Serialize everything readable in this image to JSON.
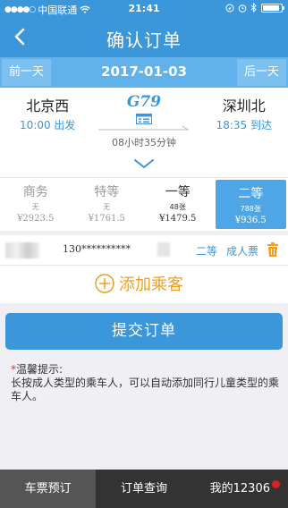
{
  "status_bar": {
    "carrier": "中国联通",
    "time": "21:41",
    "battery_level": 0.9
  },
  "nav": {
    "title": "确认订单",
    "back_icon": "chevron-left-icon"
  },
  "date_bar": {
    "prev_label": "前一天",
    "date": "2017-01-03",
    "next_label": "后一天"
  },
  "train": {
    "from_station": "北京西",
    "depart": "10:00 出发",
    "train_no": "G79",
    "duration": "08小时35分钟",
    "to_station": "深圳北",
    "arrive": "18:35 到达"
  },
  "seats": [
    {
      "name": "商务",
      "avail": "无",
      "price": "¥2923.5"
    },
    {
      "name": "特等",
      "avail": "无",
      "price": "¥1761.5"
    },
    {
      "name": "一等",
      "avail": "48张",
      "price": "¥1479.5"
    },
    {
      "name": "二等",
      "avail": "788张",
      "price": "¥936.5"
    }
  ],
  "passenger": {
    "id_number": "130**********",
    "seat_class": "二等",
    "ticket_type": "成人票"
  },
  "add_passenger_label": "添加乘客",
  "submit_label": "提交订单",
  "tips": {
    "title": "温馨提示:",
    "body": "长按成人类型的乘车人，可以自动添加同行儿童类型的乘车人。"
  },
  "tabs": [
    {
      "label": "车票预订"
    },
    {
      "label": "订单查询"
    },
    {
      "label": "我的12306"
    }
  ],
  "colors": {
    "primary": "#3b97d9",
    "accent": "#f0a020",
    "selected_seat": "#4ea6e6",
    "tabbar": "#333333"
  }
}
